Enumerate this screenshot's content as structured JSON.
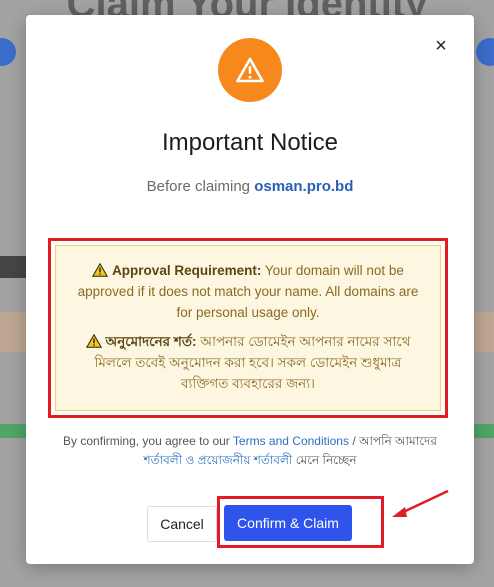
{
  "background": {
    "heading": "Claim Your Identity"
  },
  "modal": {
    "title": "Important Notice",
    "subtitle_prefix": "Before claiming",
    "domain": "osman.pro.bd",
    "notice": {
      "en_label": "Approval Requirement:",
      "en_text": " Your domain will not be approved if it does not match your name. All domains are for personal usage only.",
      "bn_label": "অনুমোদনের শর্ত:",
      "bn_text": " আপনার ডোমেইন আপনার নামের সাথে মিললে তবেই অনুমোদন করা হবে। সকল ডোমেইন শুধুমাত্র ব্যক্তিগত ব্যবহারের জন্য।"
    },
    "consent": {
      "prefix": "By confirming, you agree to our ",
      "terms_link": "Terms and Conditions",
      "separator": " / আপনি আমাদের ",
      "bn_link": "শর্তাবলী ও প্রয়োজনীয় শর্তাবলী",
      "suffix": " মেনে নিচ্ছেন"
    },
    "buttons": {
      "cancel": "Cancel",
      "confirm": "Confirm & Claim"
    },
    "close_symbol": "×"
  },
  "colors": {
    "accent": "#2f54eb",
    "warning": "#f7881b",
    "highlight": "#e01d24",
    "link": "#2b6fc0"
  }
}
